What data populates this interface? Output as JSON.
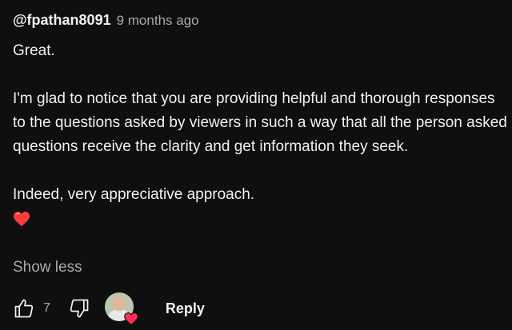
{
  "comment": {
    "author": "@fpathan8091",
    "time": "9 months ago",
    "body": {
      "line1": "Great.",
      "paragraph2": "I'm glad to notice that you are providing helpful and thorough responses to the questions asked by viewers in such a way that all the person asked questions receive the clarity and get information they seek.",
      "paragraph3": "Indeed, very appreciative approach.",
      "emoji": "heart-emoji"
    },
    "show_less_label": "Show less",
    "actions": {
      "like_icon": "thumbs-up-icon",
      "like_count": "7",
      "dislike_icon": "thumbs-down-icon",
      "creator_heart": "creator-heart-avatar",
      "reply_label": "Reply"
    },
    "colors": {
      "background": "#0f0f0f",
      "primary_text": "#f1f1f1",
      "secondary_text": "#aaaaaa",
      "heart": "#ff2d55"
    }
  }
}
